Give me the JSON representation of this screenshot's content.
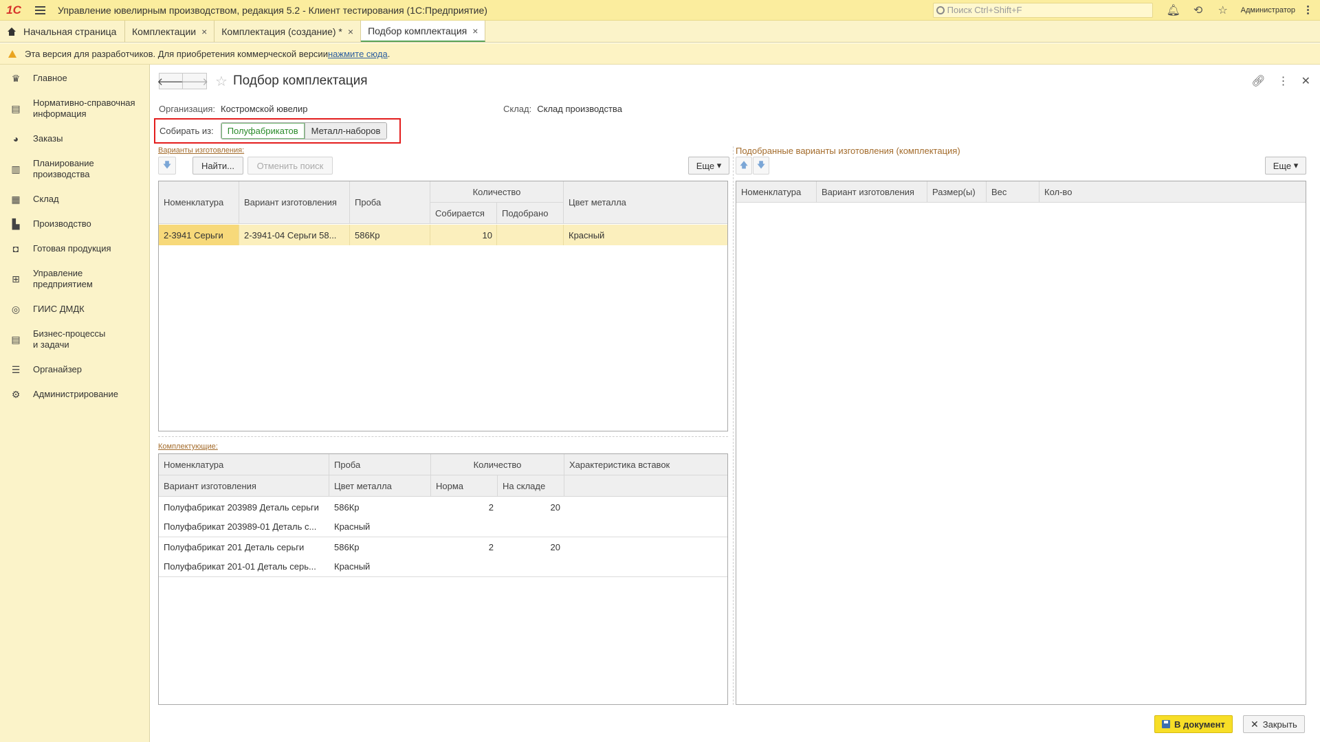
{
  "app": {
    "logo": "1С",
    "title": "Управление ювелирным производством, редакция 5.2  - Клиент тестирования (1С:Предприятие)",
    "search_placeholder": "Поиск Ctrl+Shift+F",
    "user": "Администратор"
  },
  "tabs": [
    {
      "label": "Начальная страница",
      "icon": "home-icon"
    },
    {
      "label": "Комплектации"
    },
    {
      "label": "Комплектация (создание) *"
    },
    {
      "label": "Подбор комплектация",
      "active": true
    }
  ],
  "warning": {
    "text": "Эта версия для разработчиков. Для приобретения коммерческой версии ",
    "link": "нажмите сюда",
    "tail": "."
  },
  "sidebar": {
    "items": [
      {
        "label": "Главное",
        "icon": "crown-icon"
      },
      {
        "label": "Нормативно-справочная информация",
        "icon": "book-icon"
      },
      {
        "label": "Заказы",
        "icon": "pie-icon"
      },
      {
        "label": "Планирование производства",
        "icon": "clipboard-icon"
      },
      {
        "label": "Склад",
        "icon": "grid-icon"
      },
      {
        "label": "Производство",
        "icon": "factory-icon"
      },
      {
        "label": "Готовая продукция",
        "icon": "bag-icon"
      },
      {
        "label": "Управление предприятием",
        "icon": "chart-icon"
      },
      {
        "label": "ГИИС ДМДК",
        "icon": "ring-icon"
      },
      {
        "label": "Бизнес-процессы и задачи",
        "icon": "tasks-icon"
      },
      {
        "label": "Органайзер",
        "icon": "organizer-icon"
      },
      {
        "label": "Администрирование",
        "icon": "gear-icon"
      }
    ]
  },
  "form": {
    "title": "Подбор комплектация",
    "org_label": "Организация:",
    "org_value": "Костромской ювелир",
    "warehouse_label": "Склад:",
    "warehouse_value": "Склад производства",
    "collect_label": "Собирать из:",
    "collect_options": [
      "Полуфабрикатов",
      "Металл-наборов"
    ],
    "variants_label": "Варианты изготовления:",
    "find_btn": "Найти...",
    "cancel_search_btn": "Отменить поиск",
    "more_btn": "Еще",
    "selected_label": "Подобранные варианты изготовления (комплектация)",
    "components_label": "Комплектующие:",
    "to_doc_btn": "В документ",
    "close_btn": "Закрыть"
  },
  "variants_table": {
    "headers": {
      "nomenclature": "Номенклатура",
      "variant": "Вариант изготовления",
      "assay": "Проба",
      "quantity": "Количество",
      "collecting": "Собирается",
      "picked": "Подобрано",
      "metal_color": "Цвет металла"
    },
    "rows": [
      {
        "nomenclature": "2-3941 Серьги",
        "variant": "2-3941-04 Серьги 58...",
        "assay": "586Кр",
        "collecting": "10",
        "picked": "",
        "metal_color": "Красный"
      }
    ]
  },
  "components_table": {
    "headers": {
      "nomenclature": "Номенклатура",
      "variant": "Вариант изготовления",
      "assay": "Проба",
      "metal_color": "Цвет металла",
      "quantity": "Количество",
      "norm": "Норма",
      "in_stock": "На складе",
      "inserts": "Характеристика вставок"
    },
    "rows": [
      {
        "nomenclature": "Полуфабрикат 203989 Деталь серьги",
        "variant": "Полуфабрикат 203989-01 Деталь с...",
        "assay": "586Кр",
        "metal_color": "Красный",
        "norm": "2",
        "in_stock": "20"
      },
      {
        "nomenclature": "Полуфабрикат 201 Деталь серьги",
        "variant": "Полуфабрикат 201-01 Деталь серь...",
        "assay": "586Кр",
        "metal_color": "Красный",
        "norm": "2",
        "in_stock": "20"
      }
    ]
  },
  "selected_table": {
    "headers": [
      "Номенклатура",
      "Вариант изготовления",
      "Размер(ы)",
      "Вес",
      "Кол-во"
    ]
  }
}
